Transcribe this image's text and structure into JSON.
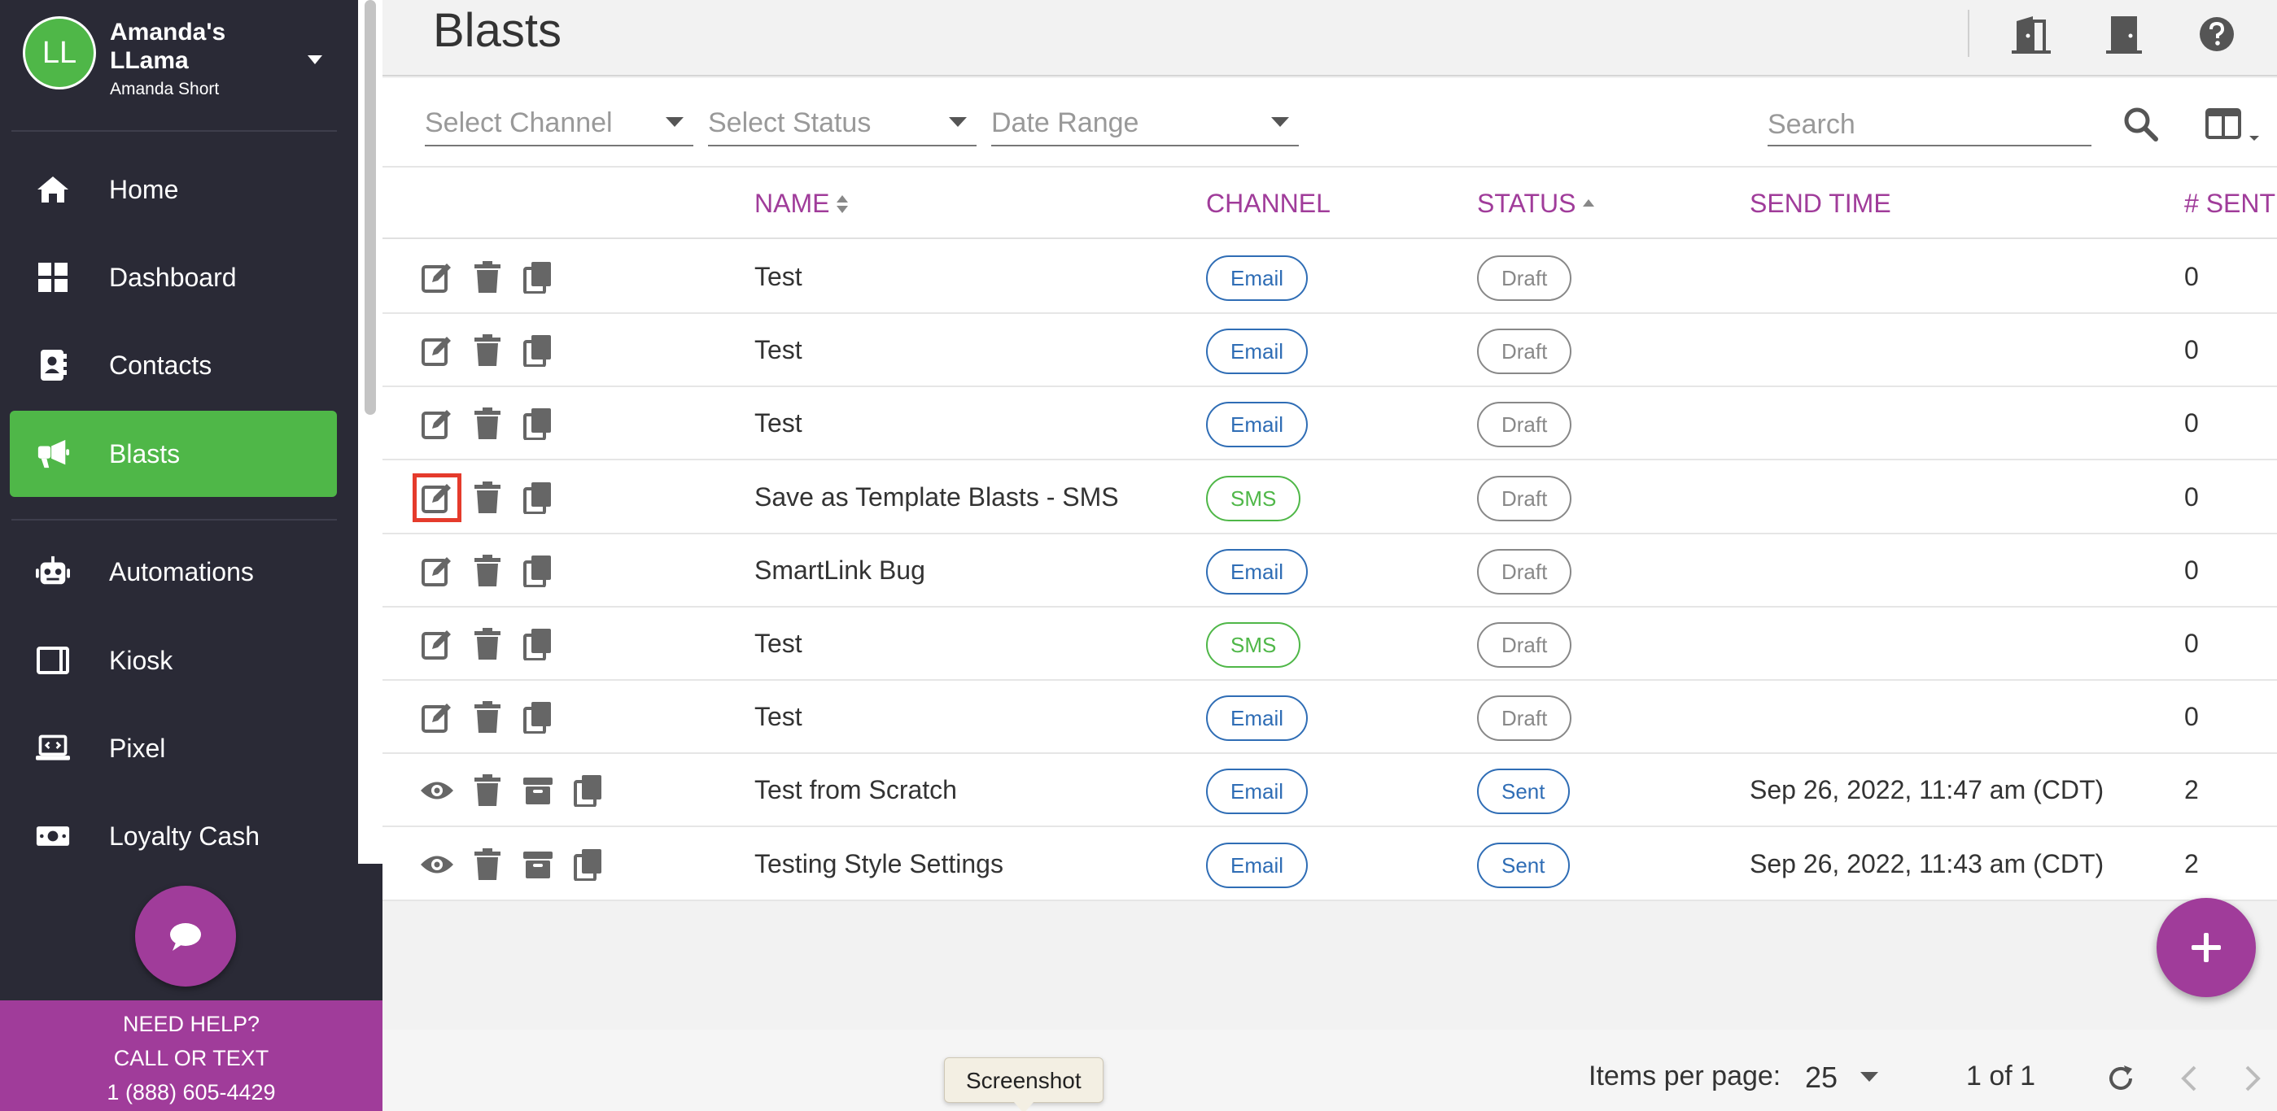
{
  "profile": {
    "initials": "LL",
    "org_name": "Amanda's LLama",
    "user_name": "Amanda Short"
  },
  "sidebar": {
    "items": [
      {
        "label": "Home",
        "icon": "home-icon"
      },
      {
        "label": "Dashboard",
        "icon": "dashboard-icon"
      },
      {
        "label": "Contacts",
        "icon": "contacts-icon"
      },
      {
        "label": "Blasts",
        "icon": "megaphone-icon",
        "active": true
      },
      {
        "label": "Automations",
        "icon": "robot-icon"
      },
      {
        "label": "Kiosk",
        "icon": "tablet-icon"
      },
      {
        "label": "Pixel",
        "icon": "laptop-code-icon"
      },
      {
        "label": "Loyalty Cash",
        "icon": "money-icon"
      }
    ]
  },
  "help": {
    "line1": "NEED HELP?",
    "line2": "CALL OR TEXT",
    "phone": "1 (888) 605-4429"
  },
  "header": {
    "title": "Blasts"
  },
  "filters": {
    "channel_placeholder": "Select Channel",
    "status_placeholder": "Select Status",
    "date_placeholder": "Date Range",
    "search_placeholder": "Search"
  },
  "table": {
    "columns": {
      "name": "NAME",
      "channel": "CHANNEL",
      "status": "STATUS",
      "send_time": "SEND TIME",
      "sent": "# SENT"
    },
    "rows": [
      {
        "name": "Test",
        "channel": "Email",
        "status": "Draft",
        "send_time": "",
        "sent": "0"
      },
      {
        "name": "Test",
        "channel": "Email",
        "status": "Draft",
        "send_time": "",
        "sent": "0"
      },
      {
        "name": "Test",
        "channel": "Email",
        "status": "Draft",
        "send_time": "",
        "sent": "0"
      },
      {
        "name": "Save as Template Blasts - SMS",
        "channel": "SMS",
        "status": "Draft",
        "send_time": "",
        "sent": "0"
      },
      {
        "name": "SmartLink Bug",
        "channel": "Email",
        "status": "Draft",
        "send_time": "",
        "sent": "0"
      },
      {
        "name": "Test",
        "channel": "SMS",
        "status": "Draft",
        "send_time": "",
        "sent": "0"
      },
      {
        "name": "Test",
        "channel": "Email",
        "status": "Draft",
        "send_time": "",
        "sent": "0"
      },
      {
        "name": "Test from Scratch",
        "channel": "Email",
        "status": "Sent",
        "send_time": "Sep 26, 2022, 11:47 am (CDT)",
        "sent": "2"
      },
      {
        "name": "Testing Style Settings",
        "channel": "Email",
        "status": "Sent",
        "send_time": "Sep 26, 2022, 11:43 am (CDT)",
        "sent": "2"
      }
    ]
  },
  "pagination": {
    "items_per_page_label": "Items per page:",
    "items_per_page": "25",
    "range": "1 of 1"
  },
  "tooltip": {
    "text": "Screenshot"
  },
  "colors": {
    "sidebar_bg": "#2a2a36",
    "accent_green": "#4fb748",
    "accent_purple": "#a03c9a",
    "email_blue": "#2f6db5",
    "highlight_red": "#e53b2c"
  }
}
